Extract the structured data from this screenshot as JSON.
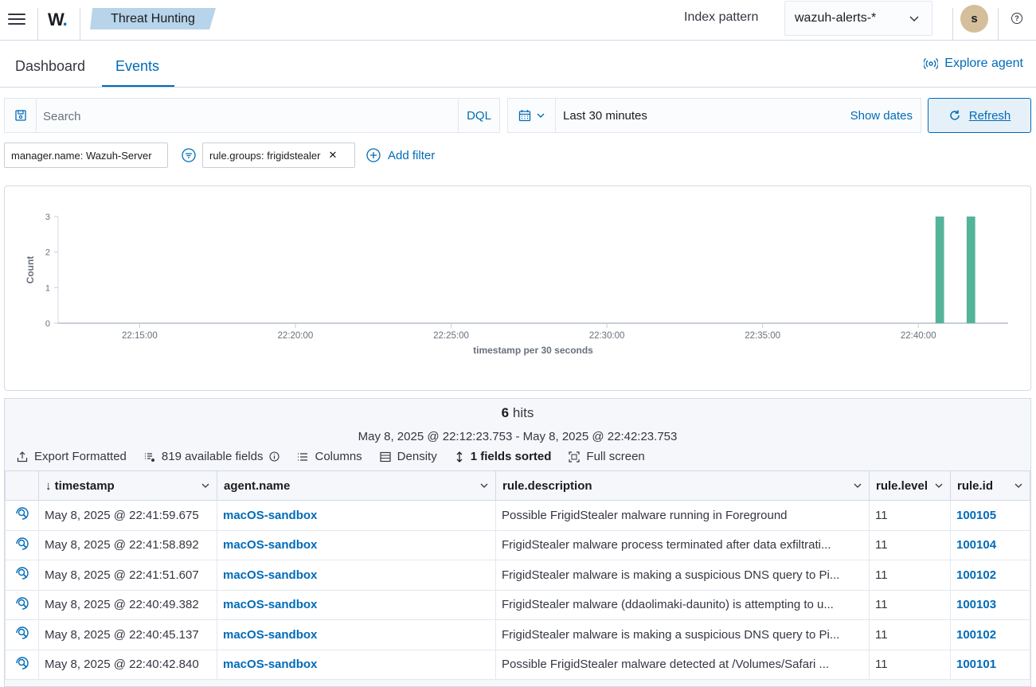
{
  "header": {
    "logo_text": "W",
    "breadcrumb": "Threat Hunting",
    "index_pattern_label": "Index pattern",
    "index_pattern_value": "wazuh-alerts-*",
    "avatar_initial": "s"
  },
  "tabs": {
    "dashboard": "Dashboard",
    "events": "Events",
    "explore_agent": "Explore agent"
  },
  "query": {
    "placeholder": "Search",
    "language": "DQL",
    "time_range": "Last 30 minutes",
    "show_dates": "Show dates",
    "refresh": "Refresh"
  },
  "filters": {
    "pill1": "manager.name: Wazuh-Server",
    "pill2": "rule.groups: frigidstealer",
    "add_filter": "Add filter"
  },
  "chart_data": {
    "type": "bar",
    "xlabel": "timestamp per 30 seconds",
    "ylabel": "Count",
    "ylim": [
      0,
      3
    ],
    "yticks": [
      "0",
      "1",
      "2",
      "3"
    ],
    "xticks": [
      "22:15:00",
      "22:20:00",
      "22:25:00",
      "22:30:00",
      "22:35:00",
      "22:40:00"
    ],
    "categories": [
      "22:40:30",
      "22:41:30"
    ],
    "values": [
      3,
      3
    ],
    "color": "#54b399"
  },
  "results": {
    "hits_count": "6",
    "hits_label": "hits",
    "date_range": "May 8, 2025 @ 22:12:23.753 - May 8, 2025 @ 22:42:23.753",
    "toolbar": {
      "export": "Export Formatted",
      "fields": "819 available fields",
      "columns": "Columns",
      "density": "Density",
      "sorted": "1 fields sorted",
      "fullscreen": "Full screen"
    },
    "columns": [
      "timestamp",
      "agent.name",
      "rule.description",
      "rule.level",
      "rule.id"
    ],
    "rows": [
      {
        "timestamp": "May 8, 2025 @ 22:41:59.675",
        "agent": "macOS-sandbox",
        "description": "Possible FrigidStealer malware running in Foreground",
        "level": "11",
        "id": "100105"
      },
      {
        "timestamp": "May 8, 2025 @ 22:41:58.892",
        "agent": "macOS-sandbox",
        "description": "FrigidStealer malware process terminated after data exfiltrati...",
        "level": "11",
        "id": "100104"
      },
      {
        "timestamp": "May 8, 2025 @ 22:41:51.607",
        "agent": "macOS-sandbox",
        "description": "FrigidStealer malware is making a suspicious DNS query to Pi...",
        "level": "11",
        "id": "100102"
      },
      {
        "timestamp": "May 8, 2025 @ 22:40:49.382",
        "agent": "macOS-sandbox",
        "description": "FrigidStealer malware (ddaolimaki-daunito) is attempting to u...",
        "level": "11",
        "id": "100103"
      },
      {
        "timestamp": "May 8, 2025 @ 22:40:45.137",
        "agent": "macOS-sandbox",
        "description": "FrigidStealer malware is making a suspicious DNS query to Pi...",
        "level": "11",
        "id": "100102"
      },
      {
        "timestamp": "May 8, 2025 @ 22:40:42.840",
        "agent": "macOS-sandbox",
        "description": "Possible FrigidStealer malware detected at /Volumes/Safari ...",
        "level": "11",
        "id": "100101"
      }
    ]
  }
}
